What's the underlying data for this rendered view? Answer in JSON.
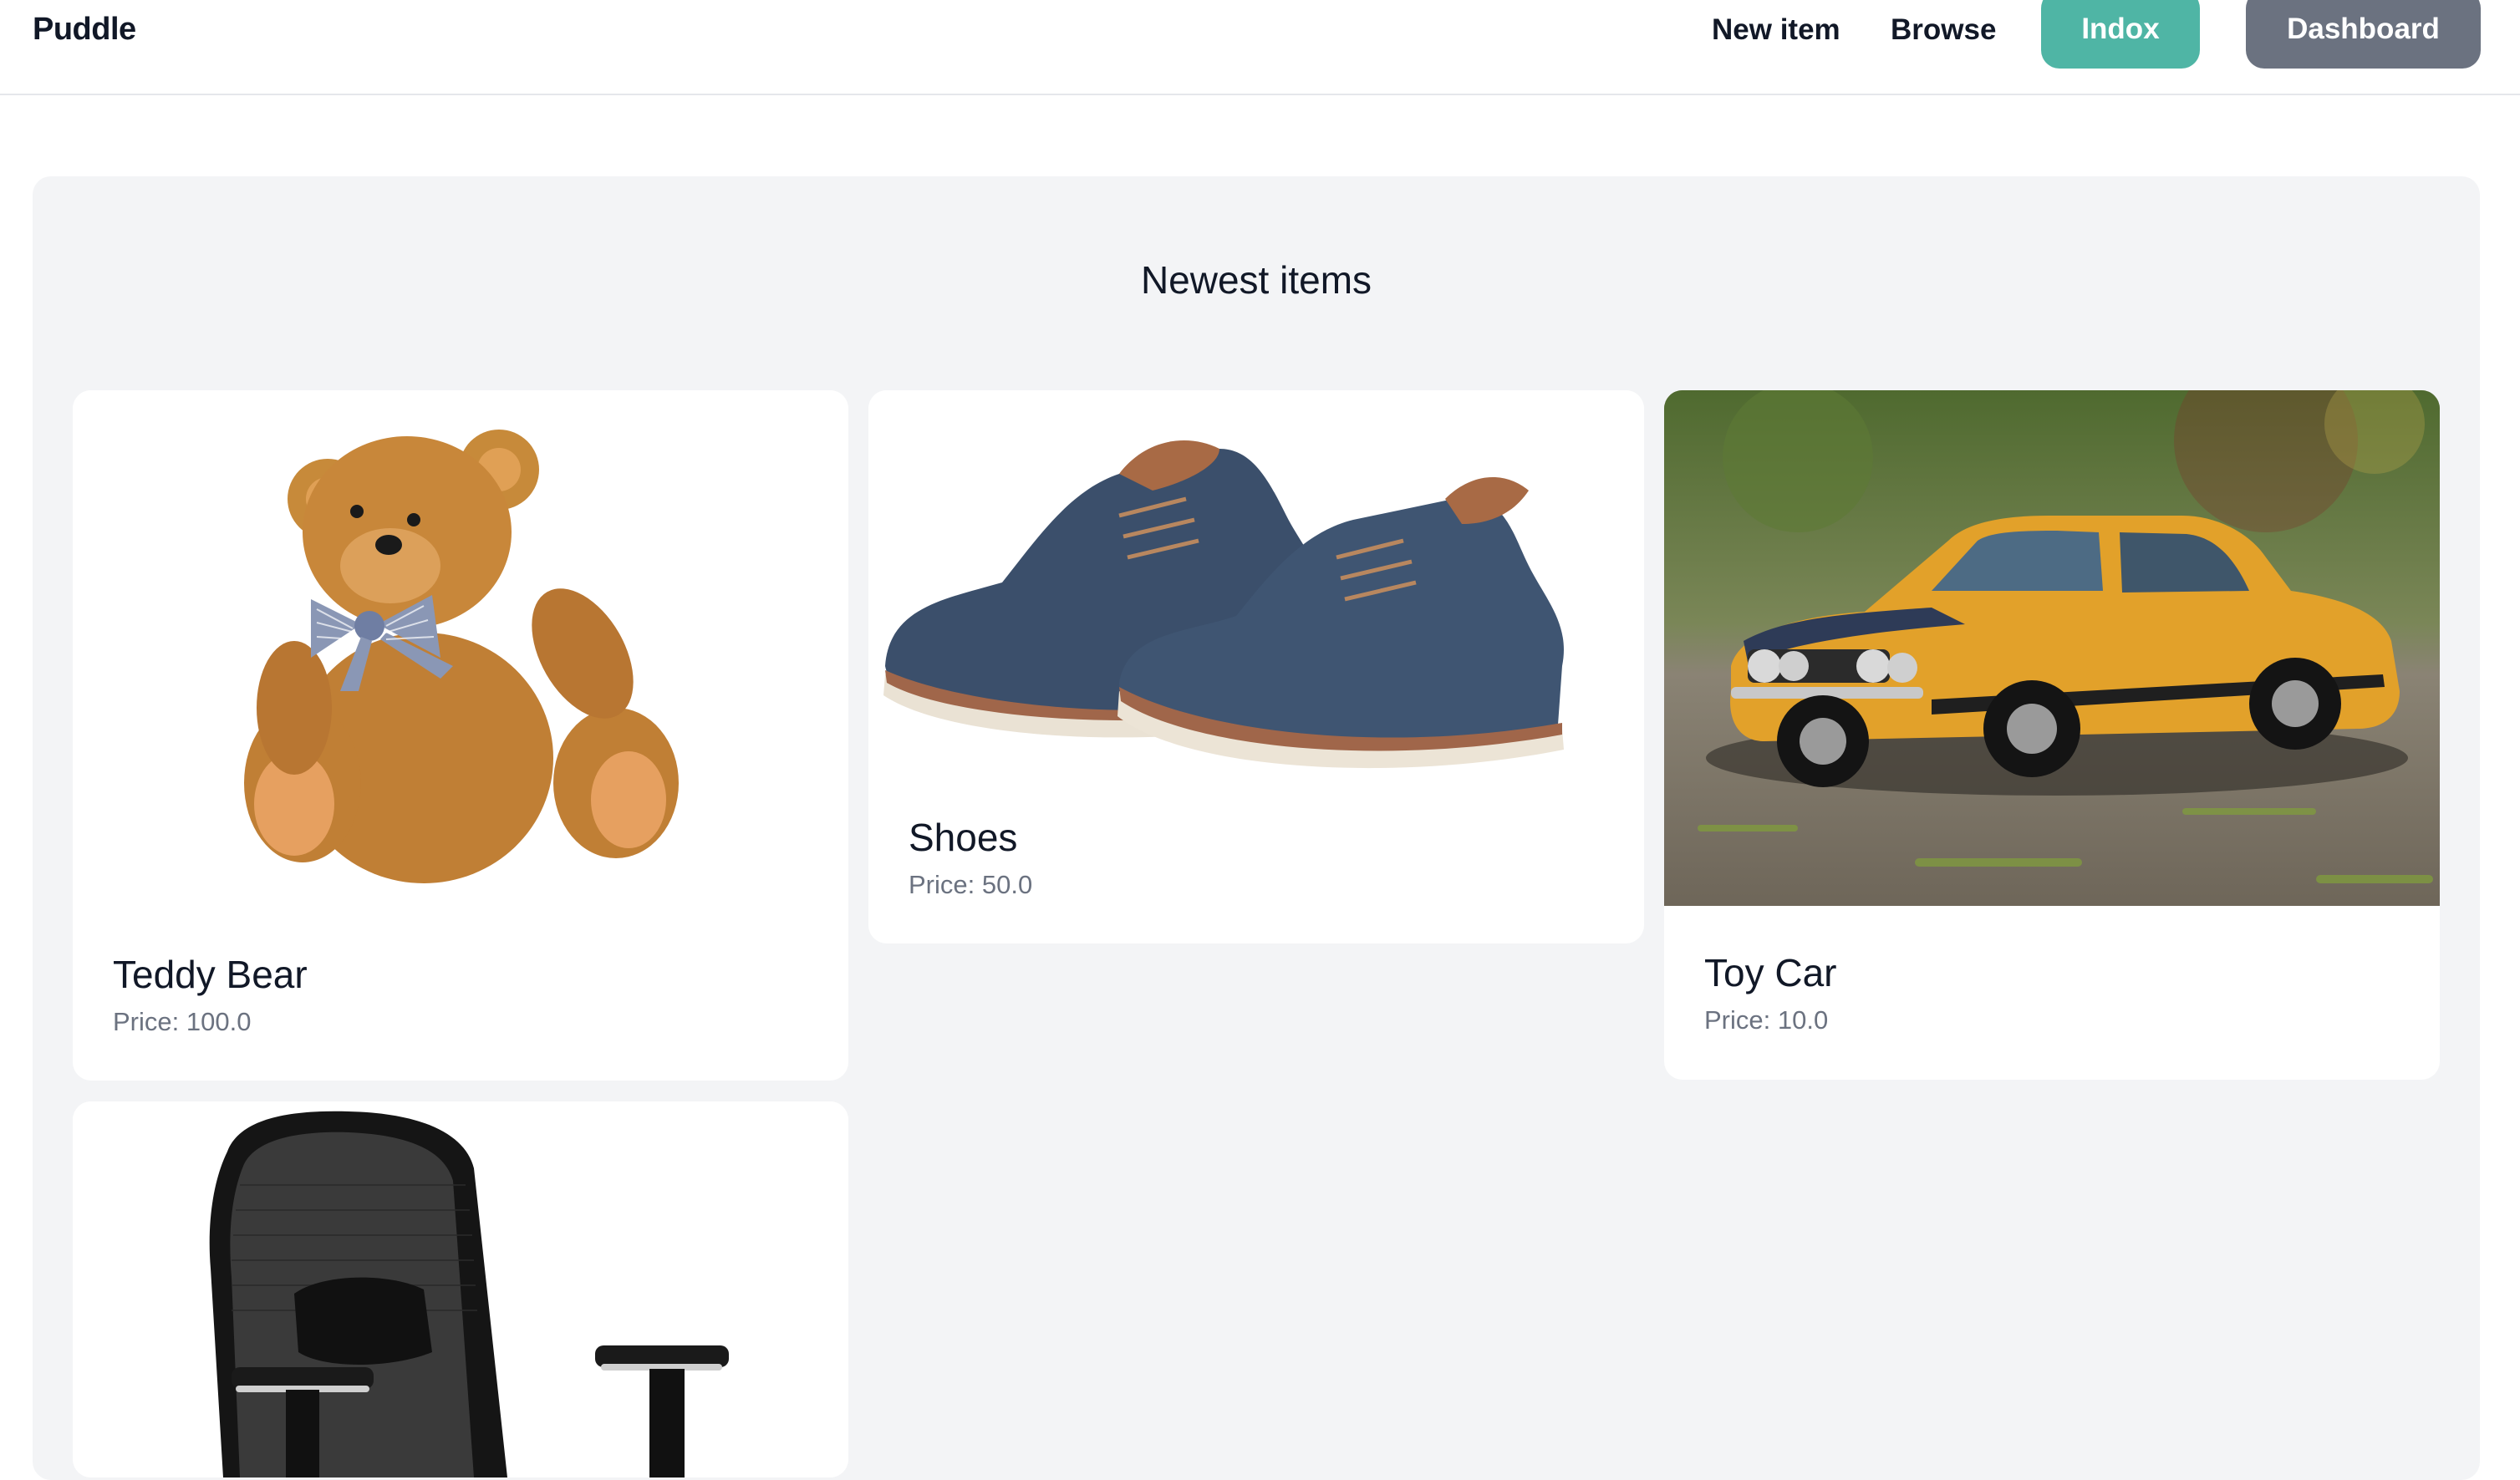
{
  "nav": {
    "brand": "Puddle",
    "new_item": "New item",
    "browse": "Browse",
    "inbox": "Indox",
    "dashboard": "Dashboard",
    "inbox_color": "#4fb5a5",
    "dashboard_color": "#6b7280"
  },
  "main": {
    "title": "Newest items",
    "items": [
      {
        "name": "Teddy Bear",
        "price": "Price: 100.0",
        "image": "teddy-bear-photo"
      },
      {
        "name": "Shoes",
        "price": "Price: 50.0",
        "image": "shoes-photo"
      },
      {
        "name": "Toy Car",
        "price": "Price: 10.0",
        "image": "toy-car-photo"
      },
      {
        "name": "",
        "price": "",
        "image": "office-chair-photo"
      }
    ]
  }
}
